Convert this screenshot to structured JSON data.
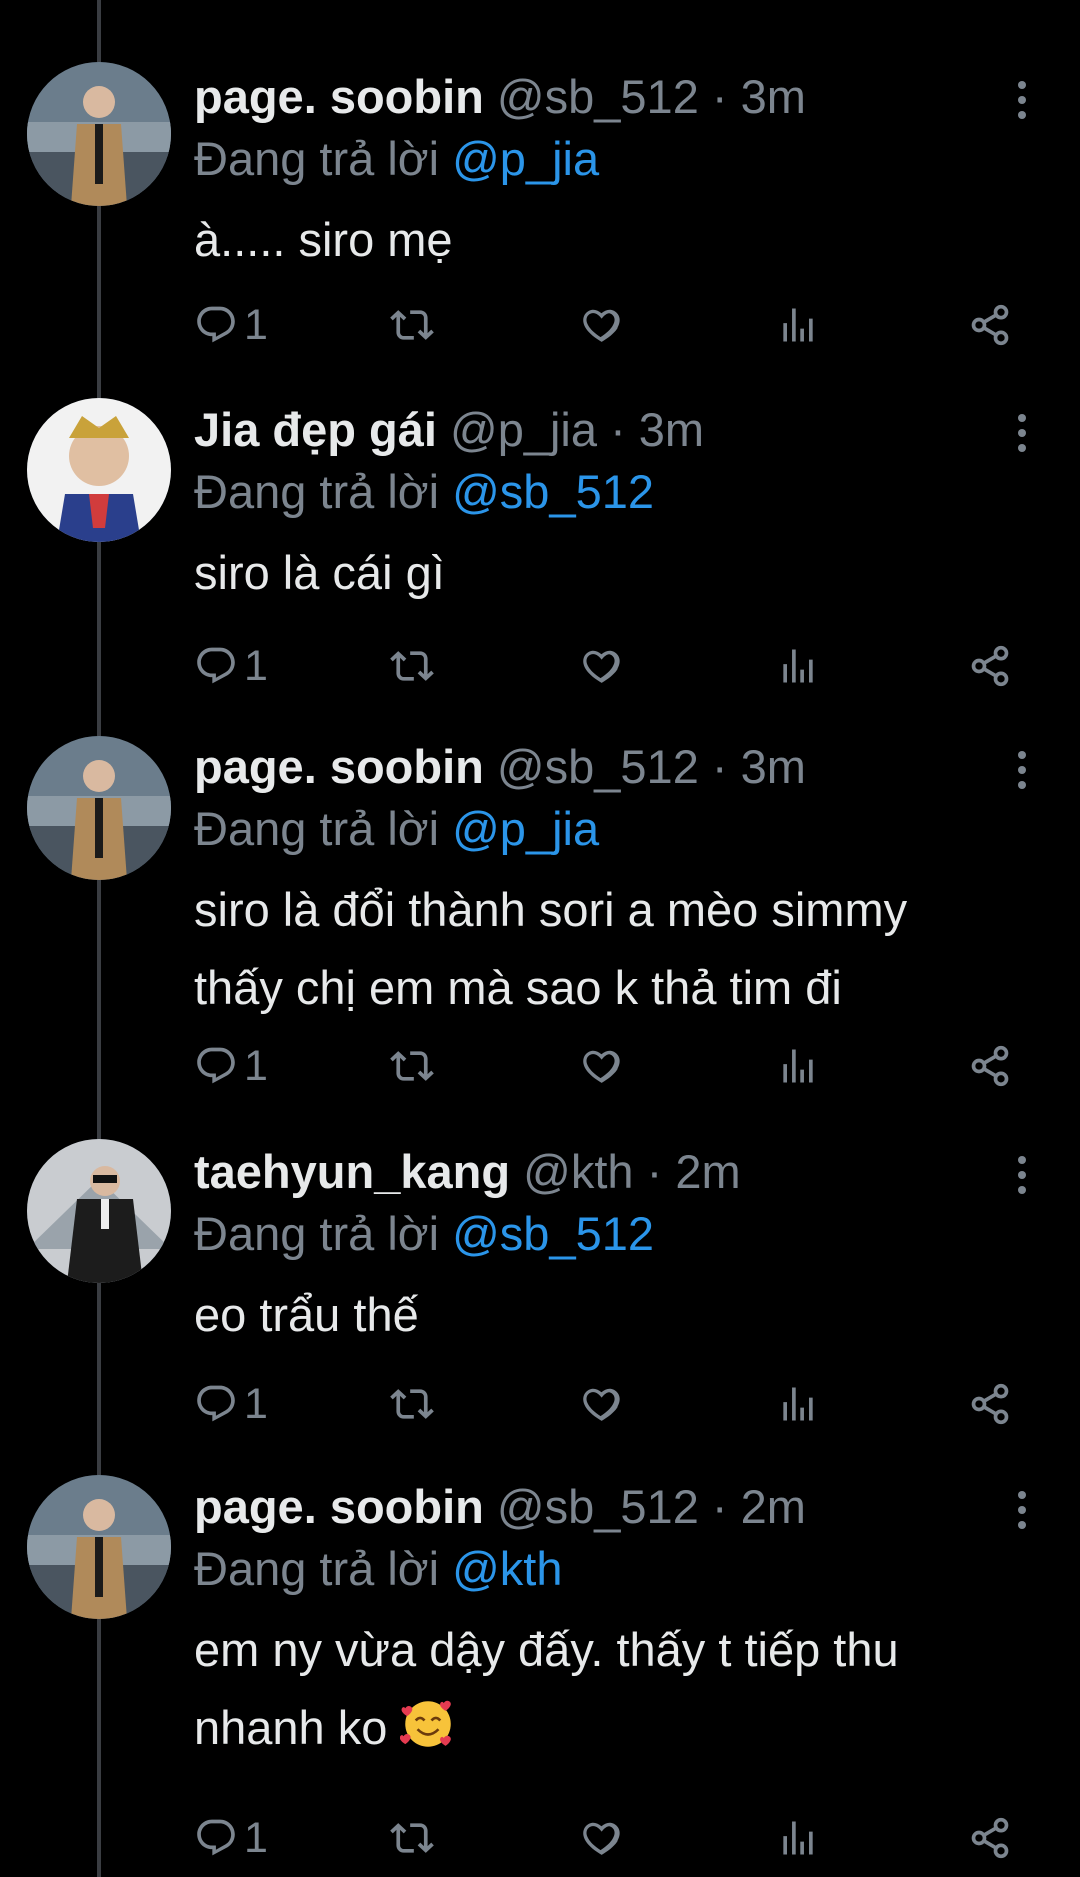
{
  "colors": {
    "background": "#000000",
    "accent": "#2b95e9",
    "muted": "#7c858f",
    "text": "#e7e9ea"
  },
  "replying_prefix": "Đang trả lời",
  "tweets": [
    {
      "name": "page. soobin",
      "handle": "@sb_512",
      "sep": "·",
      "time": "3m",
      "reply_to": "@p_jia",
      "text": "à..... siro mẹ",
      "reply_count": "1"
    },
    {
      "name": "Jia đẹp gái",
      "handle": "@p_jia",
      "sep": "·",
      "time": "3m",
      "reply_to": "@sb_512",
      "text": "siro là cái gì",
      "reply_count": "1"
    },
    {
      "name": "page. soobin",
      "handle": "@sb_512",
      "sep": "·",
      "time": "3m",
      "reply_to": "@p_jia",
      "text": "siro là đổi thành sori a mèo simmy\nthấy chị em mà sao k thả tim đi",
      "reply_count": "1"
    },
    {
      "name": "taehyun_kang",
      "handle": "@kth",
      "sep": "·",
      "time": "2m",
      "reply_to": "@sb_512",
      "text": "eo trẩu thế",
      "reply_count": "1"
    },
    {
      "name": "page. soobin",
      "handle": "@sb_512",
      "sep": "·",
      "time": "2m",
      "reply_to": "@kth",
      "text": "em ny vừa dậy đấy. thấy t tiếp thu\nnhanh ko",
      "reply_count": "1"
    }
  ],
  "icons": {
    "reply": "reply-icon",
    "retweet": "retweet-icon",
    "like": "heart-icon",
    "views": "views-icon",
    "share": "share-icon",
    "more": "more-options-icon",
    "emoji": "smiling-face-with-hearts-emoji"
  }
}
